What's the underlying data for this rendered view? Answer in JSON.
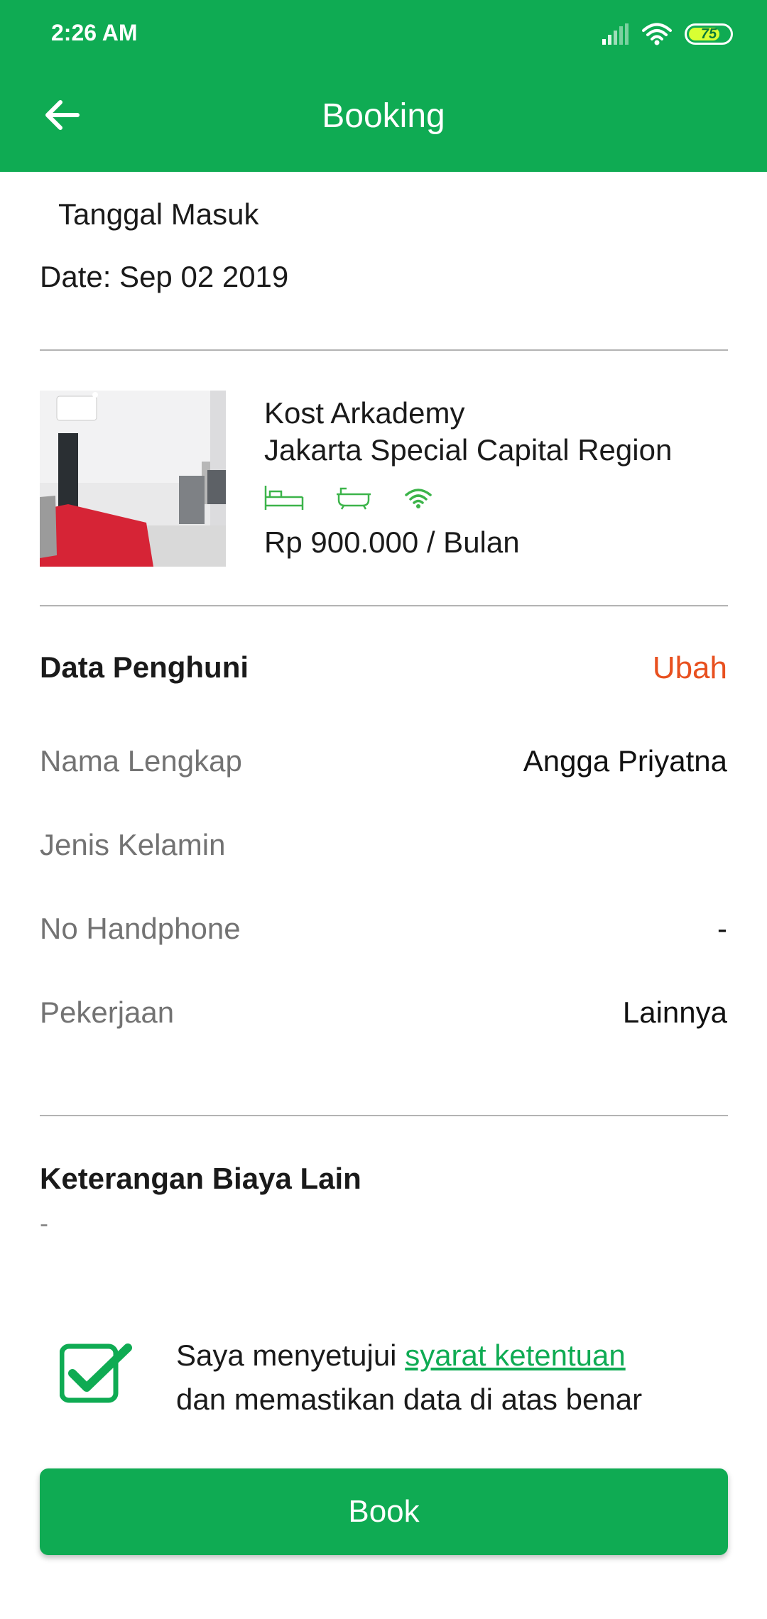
{
  "status_bar": {
    "time": "2:26 AM",
    "battery": "75"
  },
  "header": {
    "title": "Booking"
  },
  "checkin": {
    "label": "Tanggal Masuk",
    "date": "Date: Sep 02 2019"
  },
  "kost": {
    "name": "Kost Arkademy",
    "location": "Jakarta Special Capital Region",
    "price": "Rp 900.000 / Bulan",
    "facilities": [
      "bed-icon",
      "bathtub-icon",
      "wifi-icon"
    ]
  },
  "tenant": {
    "title": "Data Penghuni",
    "edit_label": "Ubah",
    "rows": [
      {
        "label": "Nama Lengkap",
        "value": "Angga Priyatna"
      },
      {
        "label": "Jenis Kelamin",
        "value": ""
      },
      {
        "label": "No Handphone",
        "value": "-"
      },
      {
        "label": "Pekerjaan",
        "value": "Lainnya"
      }
    ]
  },
  "other_costs": {
    "title": "Keterangan Biaya Lain",
    "value": "-"
  },
  "agreement": {
    "checked": true,
    "prefix": "Saya menyetujui ",
    "link": "syarat ketentuan",
    "suffix": " dan memastikan data di atas benar"
  },
  "book_button": {
    "label": "Book"
  },
  "colors": {
    "primary": "#0fab53",
    "accent": "#e8501f",
    "muted": "#737373"
  }
}
